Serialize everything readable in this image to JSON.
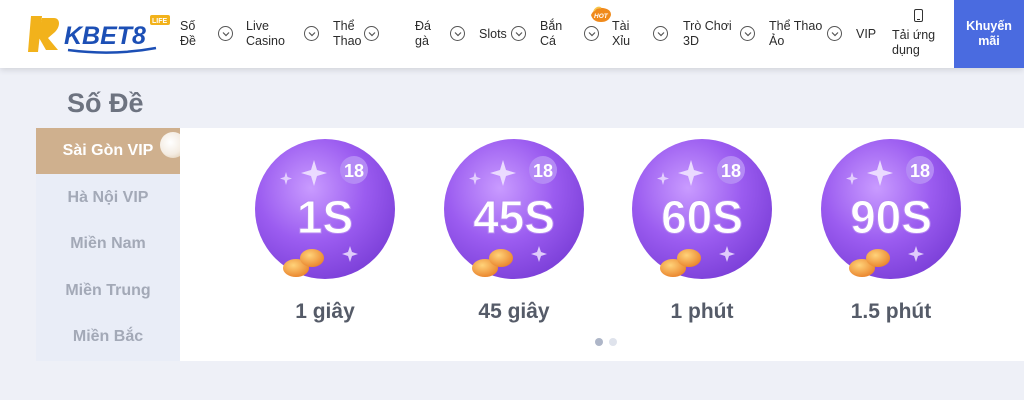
{
  "header": {
    "logo_text": "KBET8",
    "logo_badge": "LIFE",
    "nav": [
      {
        "label": "Số\nĐề"
      },
      {
        "label": "Live\nCasino"
      },
      {
        "label": "Thể\nThao"
      },
      {
        "label": "Đá\ngà"
      },
      {
        "label": "Slots"
      },
      {
        "label": "Bắn\nCá"
      },
      {
        "label": "Tài\nXỉu",
        "badge": "HOT"
      },
      {
        "label": "Trò Chơi\n3D"
      },
      {
        "label": "Thể Thao\nẢo"
      },
      {
        "label": "VIP"
      },
      {
        "label": "Tải ứng\ndụng"
      }
    ],
    "promo_label": "Khuyến\nmãi"
  },
  "section_title": "Số Đề",
  "sidebar": {
    "items": [
      {
        "label": "Sài Gòn VIP",
        "active": true
      },
      {
        "label": "Hà Nội VIP",
        "active": false
      },
      {
        "label": "Miền Nam",
        "active": false
      },
      {
        "label": "Miền Trung",
        "active": false
      },
      {
        "label": "Miền Bắc",
        "active": false
      }
    ]
  },
  "games": [
    {
      "ball_text": "1S",
      "badge": "18",
      "label": "1 giây"
    },
    {
      "ball_text": "45S",
      "badge": "18",
      "label": "45 giây"
    },
    {
      "ball_text": "60S",
      "badge": "18",
      "label": "1 phút"
    },
    {
      "ball_text": "90S",
      "badge": "18",
      "label": "1.5 phút"
    }
  ],
  "carousel": {
    "pages": 2,
    "current": 1
  },
  "colors": {
    "accent_blue": "#4a6be0",
    "active_tab": "#cfb08e",
    "ball_purple": "#9b5cf0",
    "coin_orange": "#f59a3a"
  }
}
